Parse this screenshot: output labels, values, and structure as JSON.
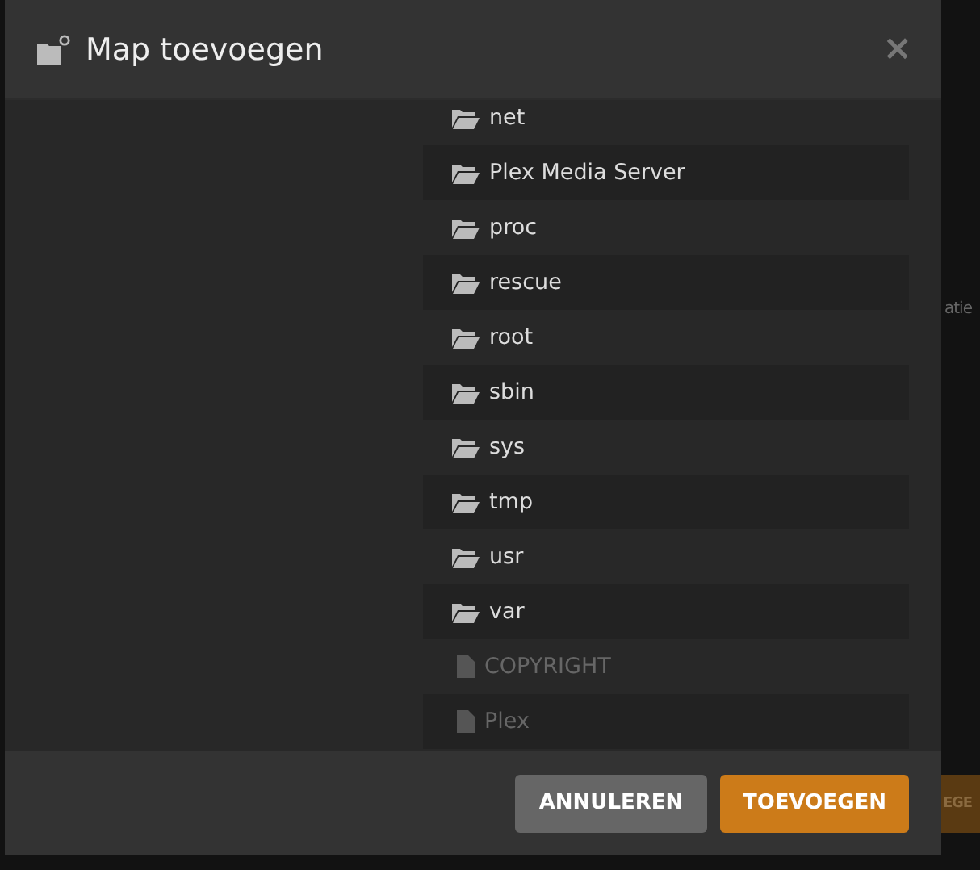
{
  "background": {
    "side_text": "atie",
    "side_button": "EGE"
  },
  "dialog": {
    "title": "Map toevoegen",
    "close": "×",
    "entries": [
      {
        "kind": "folder",
        "name": "net"
      },
      {
        "kind": "folder",
        "name": "Plex Media Server"
      },
      {
        "kind": "folder",
        "name": "proc"
      },
      {
        "kind": "folder",
        "name": "rescue"
      },
      {
        "kind": "folder",
        "name": "root"
      },
      {
        "kind": "folder",
        "name": "sbin"
      },
      {
        "kind": "folder",
        "name": "sys"
      },
      {
        "kind": "folder",
        "name": "tmp"
      },
      {
        "kind": "folder",
        "name": "usr"
      },
      {
        "kind": "folder",
        "name": "var"
      },
      {
        "kind": "file",
        "name": "COPYRIGHT"
      },
      {
        "kind": "file",
        "name": "Plex"
      }
    ],
    "buttons": [
      {
        "kind": "secondary",
        "label": "ANNULEREN"
      },
      {
        "kind": "primary",
        "label": "TOEVOEGEN"
      }
    ]
  }
}
